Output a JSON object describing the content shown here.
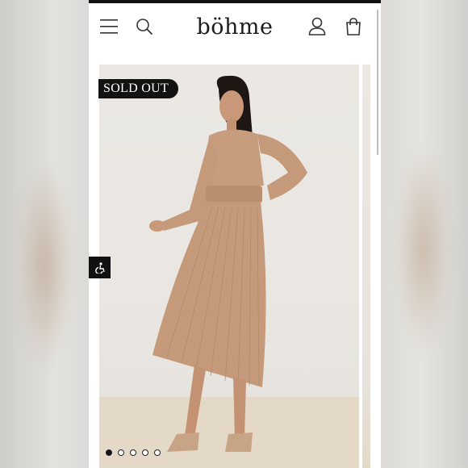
{
  "header": {
    "logo": "böhme",
    "menu_icon": "hamburger-menu-icon",
    "search_icon": "search-icon",
    "account_icon": "user-icon",
    "bag_icon": "shopping-bag-icon"
  },
  "product": {
    "badge": "SOLD OUT",
    "image_description_icon": "model-in-pleated-midi-dress",
    "dress_color": "#c49a7a"
  },
  "gallery": {
    "slides_total": 5,
    "active_slide": 1
  },
  "accessibility": {
    "icon": "accessibility-icon"
  },
  "colors": {
    "brand": "#1c1c1c",
    "badge_bg": "#121212",
    "background": "#ffffff"
  }
}
